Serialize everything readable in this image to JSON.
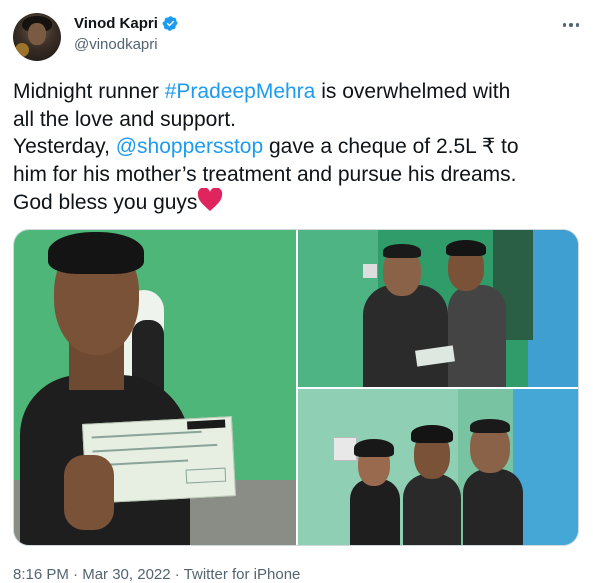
{
  "author": {
    "display_name": "Vinod Kapri",
    "handle": "@vinodkapri",
    "verified": true,
    "avatar_icon": "user-avatar"
  },
  "tweet": {
    "line1": {
      "before": "Midnight runner ",
      "hashtag": "#PradeepMehra",
      "after": " is overwhelmed with"
    },
    "line2": "all the love and support.",
    "line3": {
      "before": "Yesterday, ",
      "mention": "@shoppersstop",
      "after": " gave a cheque of 2.5L ₹ to"
    },
    "line4": "him for his mother’s treatment and pursue his dreams.",
    "line5": "God bless you guys",
    "emoji": "red-heart"
  },
  "media": {
    "photos": [
      {
        "name": "boy-holding-cheque-photo"
      },
      {
        "name": "cheque-handover-photo"
      },
      {
        "name": "group-portrait-photo"
      }
    ]
  },
  "meta": {
    "time": "8:16 PM",
    "date": "Mar 30, 2022",
    "source": "Twitter for iPhone",
    "separator": " · "
  },
  "colors": {
    "link": "#1d9bf0",
    "text": "#0f1419",
    "secondary": "#536471",
    "verified": "#1d9bf0"
  }
}
